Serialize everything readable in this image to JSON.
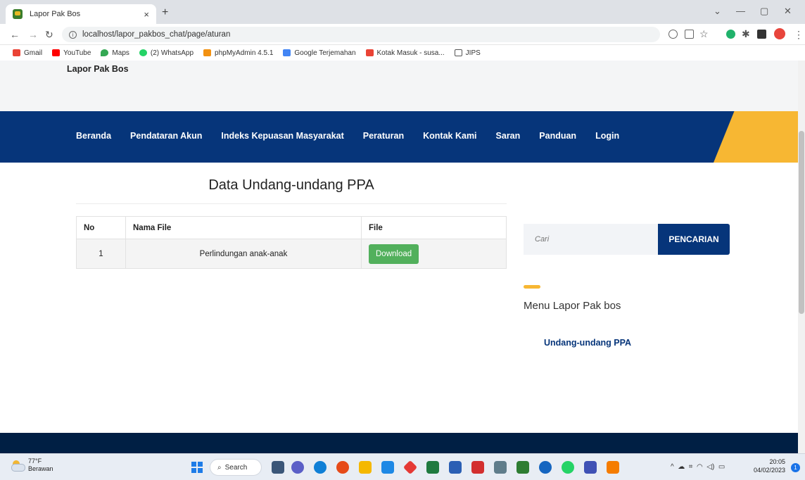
{
  "browser": {
    "tab_title": "Lapor Pak Bos",
    "tab_close": "×",
    "new_tab": "+",
    "url": "localhost/lapor_pakbos_chat/page/aturan",
    "bookmarks": [
      {
        "label": "Gmail",
        "color": "#ea4335"
      },
      {
        "label": "YouTube",
        "color": "#ff0000"
      },
      {
        "label": "Maps",
        "color": "#34a853"
      },
      {
        "label": "(2) WhatsApp",
        "color": "#25d366"
      },
      {
        "label": "phpMyAdmin 4.5.1",
        "color": "#f29111"
      },
      {
        "label": "Google Terjemahan",
        "color": "#4285f4"
      },
      {
        "label": "Kotak Masuk - susa...",
        "color": "#ea4335"
      },
      {
        "label": "JIPS",
        "color": "#555555"
      }
    ]
  },
  "site": {
    "brand": "Lapor Pak Bos",
    "menu": [
      "Beranda",
      "Pendataran Akun",
      "Indeks Kepuasan Masyarakat",
      "Peraturan",
      "Kontak Kami",
      "Saran",
      "Panduan",
      "Login"
    ],
    "accent_color": "#f7b733",
    "primary_color": "#06357a"
  },
  "content": {
    "title": "Data Undang-undang PPA",
    "table": {
      "headers": [
        "No",
        "Nama File",
        "File"
      ],
      "rows": [
        {
          "no": "1",
          "name": "Perlindungan anak-anak",
          "action": "Download"
        }
      ]
    }
  },
  "sidebar": {
    "search_placeholder": "Cari",
    "search_button": "PENCARIAN",
    "menu_title": "Menu Lapor Pak bos",
    "menu_link": "Undang-undang PPA"
  },
  "taskbar": {
    "temperature": "77°F",
    "weather": "Berawan",
    "search_label": "Search",
    "time": "20:05",
    "date": "04/02/2023",
    "notifications": "1"
  }
}
